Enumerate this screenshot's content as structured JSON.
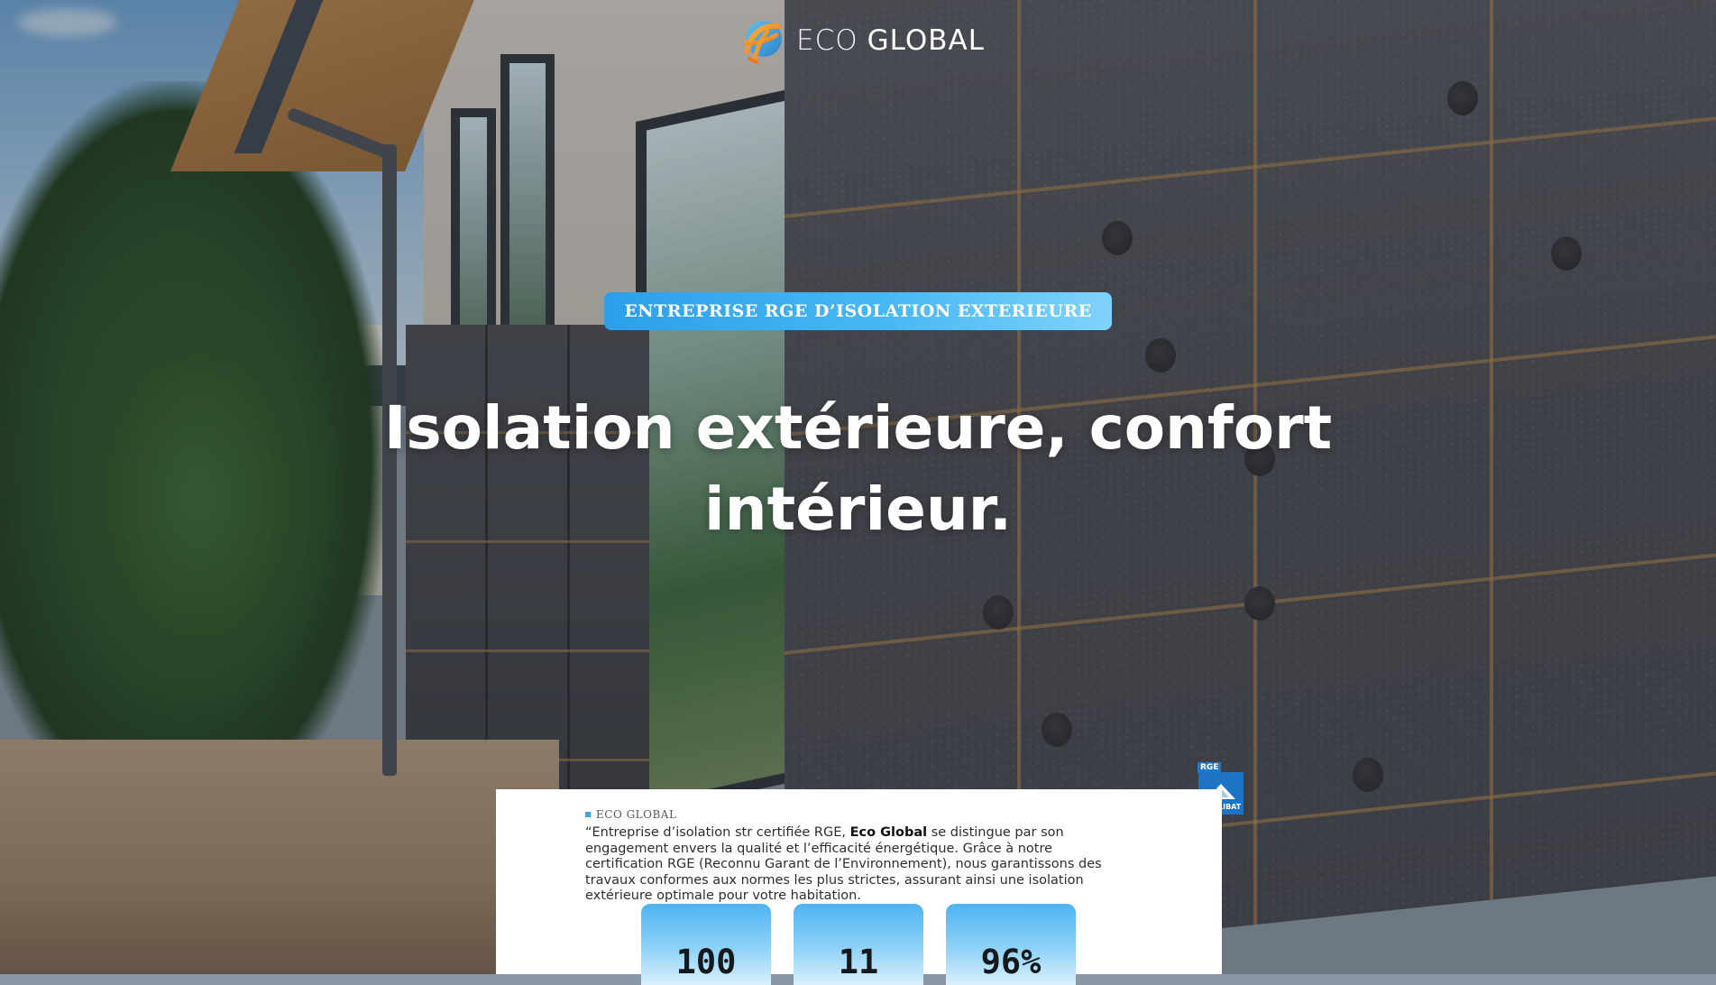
{
  "brand": {
    "name_part1": "ECO",
    "name_part2": "GLOBAL"
  },
  "hero": {
    "badge": "ENTREPRISE RGE D’ISOLATION EXTERIEURE",
    "title": "Isolation extérieure, confort intérieur."
  },
  "intro_card": {
    "eyebrow": "ECO GLOBAL",
    "text_before": "“Entreprise d’isolation str certifiée RGE, ",
    "text_bold": "Eco Global",
    "text_after": " se distingue par son engagement envers la qualité et l’efficacité énergétique. Grâce à notre certification RGE (Reconnu Garant de l’Environnement), nous garantissons des travaux conformes aux normes les plus strictes, assurant ainsi une isolation extérieure optimale pour votre habitation.",
    "stats": [
      "100",
      "11",
      "96%"
    ]
  },
  "certification": {
    "tag": "RGE",
    "label": "QUALIBAT"
  },
  "colors": {
    "accent_blue": "#3aa8ec",
    "logo_orange": "#f29a2e",
    "qualibat_blue": "#1e73c4"
  },
  "icons": {
    "logo": "eco-global-globe-logo-icon",
    "qualibat": "qualibat-house-icon"
  }
}
